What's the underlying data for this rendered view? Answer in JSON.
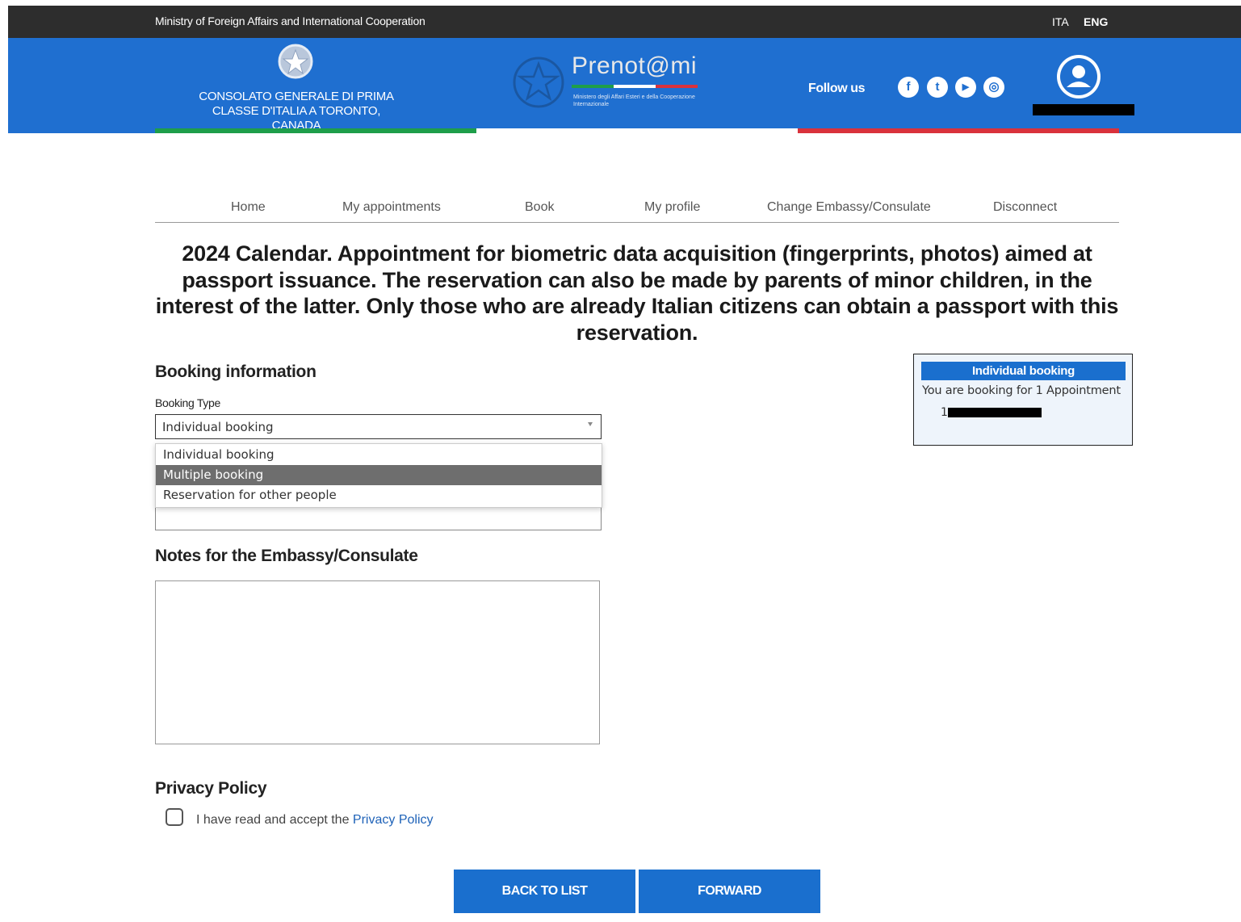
{
  "topbar": {
    "ministry": "Ministry of Foreign Affairs and International Cooperation",
    "lang_ita": "ITA",
    "lang_eng": "ENG"
  },
  "header": {
    "consulate_name": "CONSOLATO GENERALE DI PRIMA CLASSE D'ITALIA A TORONTO, CANADA",
    "logo_text": "Prenot@mi",
    "logo_sub": "Ministero degli Affari Esteri e della Cooperazione Internazionale",
    "follow_us": "Follow us",
    "social": [
      {
        "name": "facebook-icon",
        "glyph": "f"
      },
      {
        "name": "twitter-icon",
        "glyph": "t"
      },
      {
        "name": "youtube-icon",
        "glyph": "▶"
      },
      {
        "name": "instagram-icon",
        "glyph": "◎"
      }
    ],
    "colors": {
      "brand_blue": "#1f6fd0",
      "flag_green": "#1e9e4a",
      "flag_white": "#ffffff",
      "flag_red": "#d9323c"
    }
  },
  "nav": {
    "items": [
      "Home",
      "My appointments",
      "Book",
      "My profile",
      "Change Embassy/Consulate",
      "Disconnect"
    ]
  },
  "page": {
    "title": "2024 Calendar. Appointment for biometric data acquisition (fingerprints, photos) aimed at passport issuance. The reservation can also be made by parents of minor children, in the interest of the latter. Only those who are already Italian citizens can obtain a passport with this reservation."
  },
  "booking": {
    "heading": "Booking information",
    "type_label": "Booking Type",
    "type_value": "Individual booking",
    "options": [
      "Individual booking",
      "Multiple booking",
      "Reservation for other people"
    ],
    "highlighted_option": "Multiple booking"
  },
  "notes": {
    "heading": "Notes for the Embassy/Consulate",
    "value": ""
  },
  "privacy": {
    "heading": "Privacy Policy",
    "text": "I have read and accept the ",
    "link": "Privacy Policy",
    "checked": false
  },
  "buttons": {
    "back": "BACK TO LIST",
    "forward": "FORWARD"
  },
  "summary": {
    "title": "Individual booking",
    "line": "You are booking for 1 Appointment",
    "item_number": "1"
  }
}
